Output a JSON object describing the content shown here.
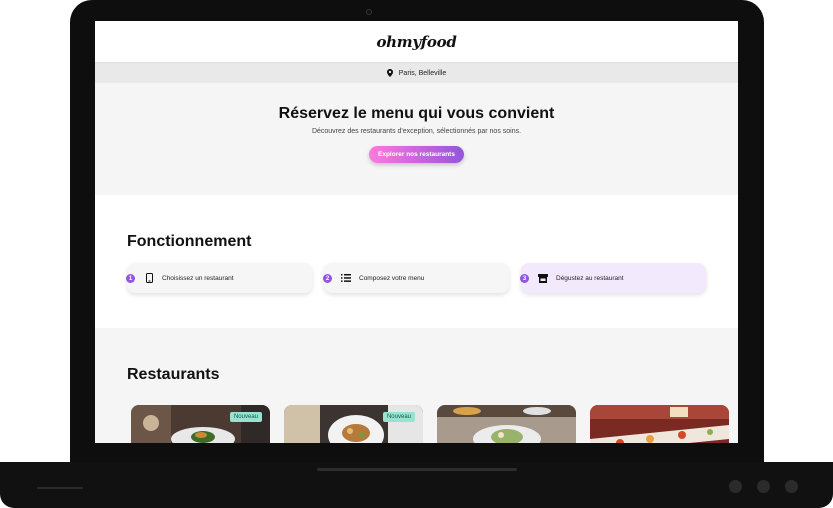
{
  "header": {
    "logo": "ohmyfood"
  },
  "location": {
    "text": "Paris, Belleville",
    "icon": "map-pin-icon"
  },
  "hero": {
    "title": "Réservez le menu qui vous convient",
    "subtitle": "Découvrez des restaurants d'exception, sélectionnés par nos soins.",
    "cta_label": "Explorer nos restaurants"
  },
  "how": {
    "title": "Fonctionnement",
    "steps": [
      {
        "number": "1",
        "label": "Choisissez un restaurant",
        "icon": "mobile-phone-icon"
      },
      {
        "number": "2",
        "label": "Composez votre menu",
        "icon": "list-icon"
      },
      {
        "number": "3",
        "label": "Dégustez au restaurant",
        "icon": "store-icon"
      }
    ]
  },
  "restaurants": {
    "title": "Restaurants",
    "cards": [
      {
        "badge": "Nouveau"
      },
      {
        "badge": "Nouveau"
      },
      {
        "badge": ""
      },
      {
        "badge": ""
      }
    ]
  },
  "colors": {
    "accent": "#9356dc",
    "accent_light": "#ff79da",
    "badge": "#99e2d0",
    "highlight_step": "#f3e9fd"
  }
}
